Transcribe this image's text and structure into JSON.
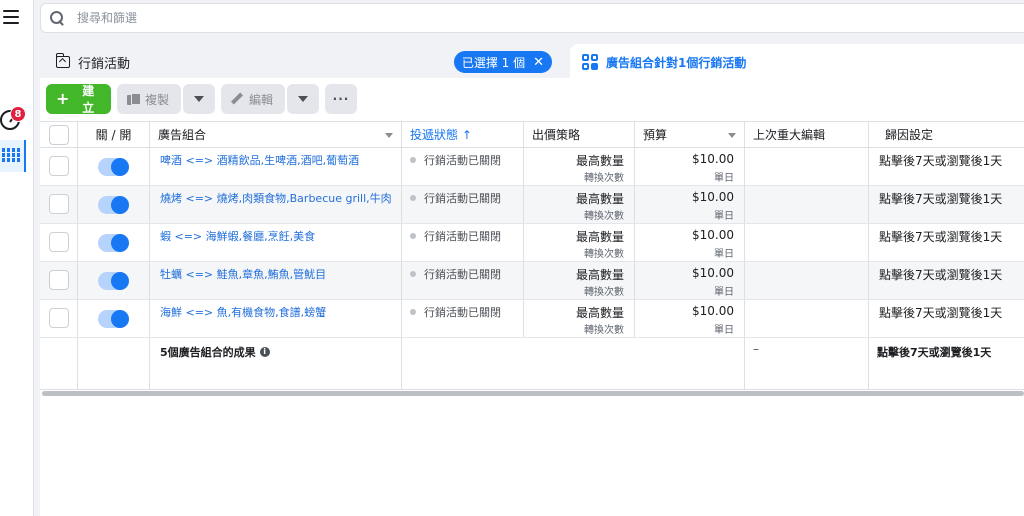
{
  "nav": {
    "notification_count": "8"
  },
  "search": {
    "placeholder": "搜尋和篩選"
  },
  "campaign_tab": {
    "title": "行銷活動",
    "selected_chip": "已選擇 1 個",
    "chip_close": "✕"
  },
  "adset_tab": {
    "title": "廣告組合針對1個行銷活動"
  },
  "toolbar": {
    "create_label": "建立",
    "create_icon": "+",
    "duplicate_label": "複製",
    "edit_label": "編輯",
    "more_label": "···"
  },
  "table": {
    "headers": {
      "toggle": "關 / 開",
      "name": "廣告組合",
      "status": "投遞狀態 ↑",
      "bid": "出價策略",
      "budget": "預算",
      "last_edit": "上次重大編輯",
      "attribution": "歸因設定"
    },
    "rows": [
      {
        "name": "啤酒 <=> 酒精飲品,生啤酒,酒吧,葡萄酒",
        "status": "行銷活動已關閉",
        "bid": "最高數量",
        "bid_sub": "轉換次數",
        "budget": "$10.00",
        "budget_sub": "單日",
        "attribution": "點擊後7天或瀏覽後1天"
      },
      {
        "name": "燒烤 <=> 燒烤,肉類食物,Barbecue grill,牛肉",
        "status": "行銷活動已關閉",
        "bid": "最高數量",
        "bid_sub": "轉換次數",
        "budget": "$10.00",
        "budget_sub": "單日",
        "attribution": "點擊後7天或瀏覽後1天"
      },
      {
        "name": "蝦 <=> 海鮮蝦,餐廳,烹飪,美食",
        "status": "行銷活動已關閉",
        "bid": "最高數量",
        "bid_sub": "轉換次數",
        "budget": "$10.00",
        "budget_sub": "單日",
        "attribution": "點擊後7天或瀏覽後1天"
      },
      {
        "name": "牡蠣 <=> 鮭魚,章魚,鮪魚,管魷目",
        "status": "行銷活動已關閉",
        "bid": "最高數量",
        "bid_sub": "轉換次數",
        "budget": "$10.00",
        "budget_sub": "單日",
        "attribution": "點擊後7天或瀏覽後1天"
      },
      {
        "name": "海鮮 <=> 魚,有機食物,食譜,螃蟹",
        "status": "行銷活動已關閉",
        "bid": "最高數量",
        "bid_sub": "轉換次數",
        "budget": "$10.00",
        "budget_sub": "單日",
        "attribution": "點擊後7天或瀏覽後1天"
      }
    ],
    "summary": {
      "label": "5個廣告組合的成果",
      "info_icon": "i",
      "last_edit": "–",
      "attribution": "點擊後7天或瀏覽後1天"
    }
  },
  "colors": {
    "accent": "#1877f2",
    "create": "#42b72a",
    "badge": "#e41e3f"
  }
}
